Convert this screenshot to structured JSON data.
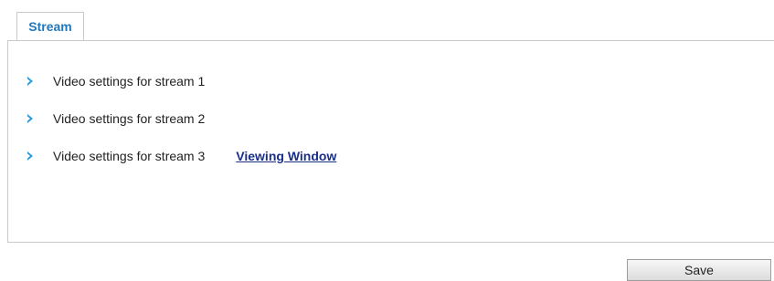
{
  "tabs": [
    {
      "label": "Stream",
      "active": true
    }
  ],
  "streams": {
    "items": [
      {
        "label": "Video settings for stream 1"
      },
      {
        "label": "Video settings for stream 2"
      },
      {
        "label": "Video settings for stream 3",
        "link_label": "Viewing Window"
      }
    ]
  },
  "footer": {
    "save_label": "Save"
  },
  "colors": {
    "tab_text": "#2277bb",
    "arrow": "#2b9bd9",
    "link": "#1a2f8a",
    "border": "#c9c9c9"
  },
  "icons": {
    "expand": "chevron-right-icon"
  }
}
